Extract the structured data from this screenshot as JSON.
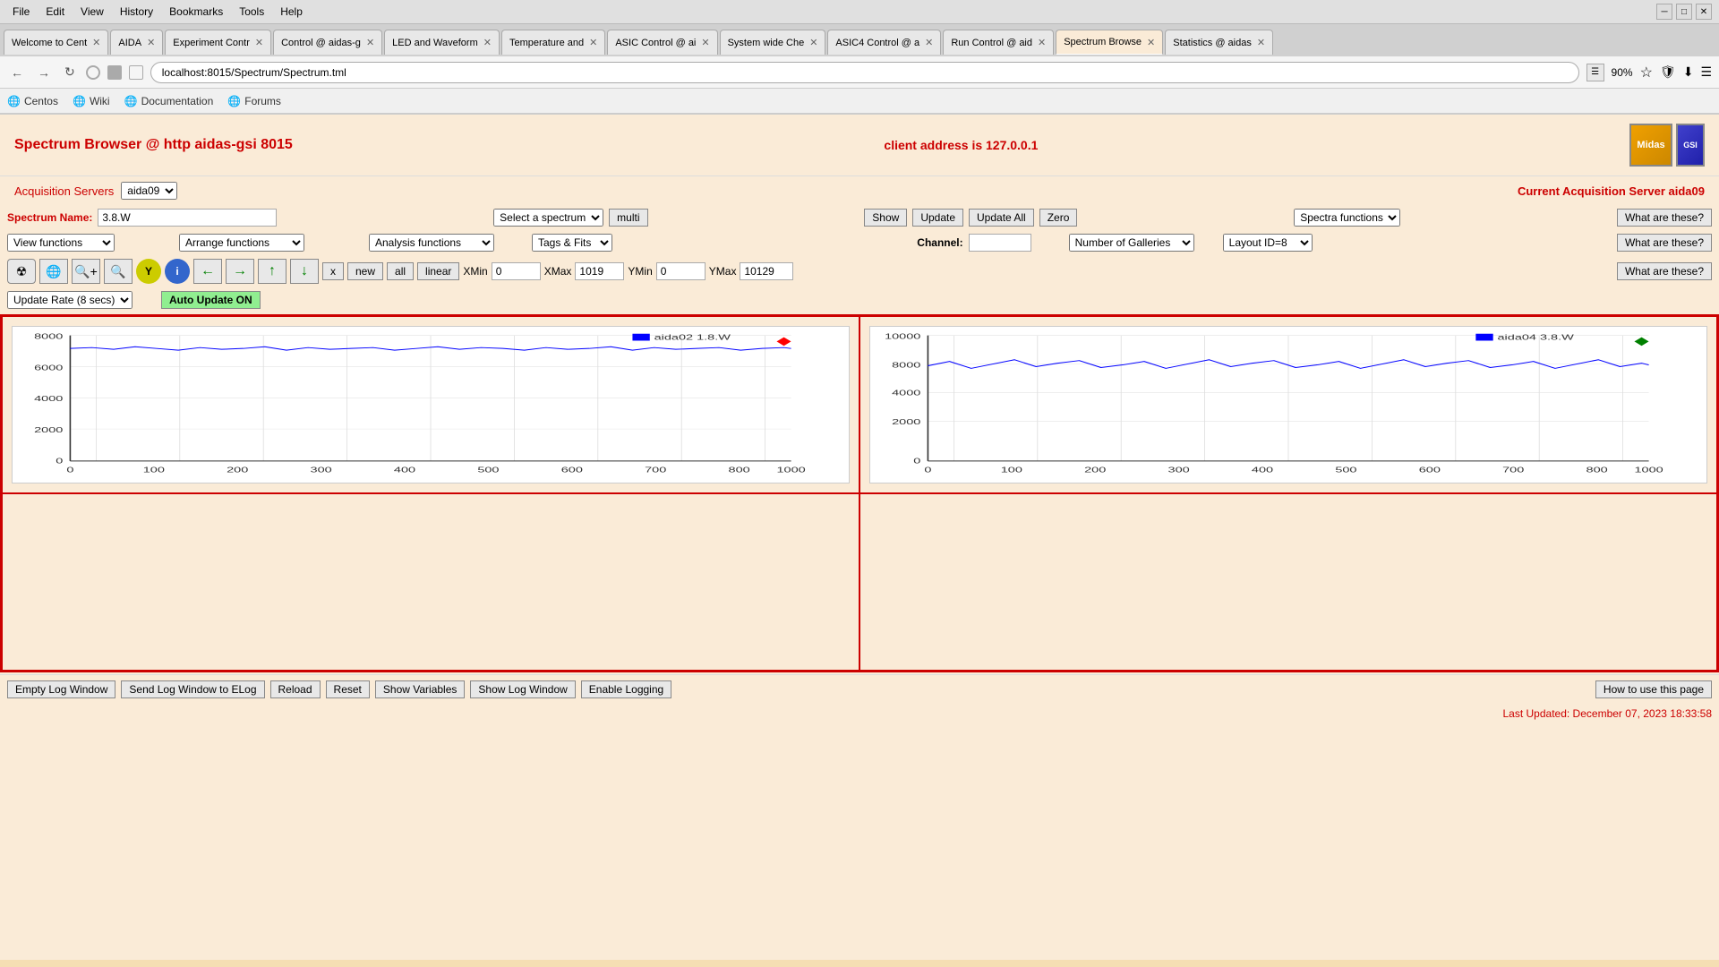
{
  "browser": {
    "menu": [
      "File",
      "Edit",
      "View",
      "History",
      "Bookmarks",
      "Tools",
      "Help"
    ],
    "tabs": [
      {
        "label": "Welcome to Cent",
        "active": false
      },
      {
        "label": "AIDA",
        "active": false
      },
      {
        "label": "Experiment Contr",
        "active": false
      },
      {
        "label": "Control @ aidas-g",
        "active": false
      },
      {
        "label": "LED and Waveform",
        "active": false
      },
      {
        "label": "Temperature and",
        "active": false
      },
      {
        "label": "ASIC Control @ ai",
        "active": false
      },
      {
        "label": "System wide Che",
        "active": false
      },
      {
        "label": "ASIC4 Control @ a",
        "active": false
      },
      {
        "label": "Run Control @ aid",
        "active": false
      },
      {
        "label": "Spectrum Browse",
        "active": true
      },
      {
        "label": "Statistics @ aidas",
        "active": false
      }
    ],
    "url": "localhost:8015/Spectrum/Spectrum.tml",
    "zoom": "90%",
    "bookmarks": [
      "Centos",
      "Wiki",
      "Documentation",
      "Forums"
    ]
  },
  "page": {
    "title": "Spectrum Browser @ http aidas-gsi 8015",
    "client_address_label": "client address is 127.0.0.1",
    "acq_servers_label": "Acquisition Servers",
    "acq_server_value": "aida09",
    "current_server_label": "Current Acquisition Server aida09",
    "spectrum_name_label": "Spectrum Name:",
    "spectrum_name_value": "3.8.W",
    "select_spectrum": "Select a spectrum",
    "multi_btn": "multi",
    "show_btn": "Show",
    "update_btn": "Update",
    "update_all_btn": "Update All",
    "zero_btn": "Zero",
    "spectra_functions": "Spectra functions",
    "what_are_these_1": "What are these?",
    "view_functions": "View functions",
    "arrange_functions": "Arrange functions",
    "analysis_functions": "Analysis functions",
    "tags_fits": "Tags & Fits",
    "channel_label": "Channel:",
    "channel_value": "",
    "number_of_galleries": "Number of Galleries",
    "layout_id": "Layout ID=8",
    "what_are_these_2": "What are these?",
    "x_btn": "x",
    "new_btn": "new",
    "all_btn": "all",
    "linear_btn": "linear",
    "xmin_label": "XMin",
    "xmin_value": "0",
    "xmax_label": "XMax",
    "xmax_value": "1019",
    "ymin_label": "YMin",
    "ymin_value": "0",
    "ymax_label": "YMax",
    "ymax_value": "10129",
    "what_are_these_3": "What are these?",
    "update_rate": "Update Rate (8 secs)",
    "auto_update_btn": "Auto Update ON",
    "chart1_label": "aida02 1.8.W",
    "chart2_label": "aida04 3.8.W",
    "footer": {
      "empty_log": "Empty Log Window",
      "send_log": "Send Log Window to ELog",
      "reload": "Reload",
      "reset": "Reset",
      "show_variables": "Show Variables",
      "show_log": "Show Log Window",
      "enable_logging": "Enable Logging",
      "how_to_use": "How to use this page",
      "last_updated": "Last Updated: December 07, 2023 18:33:58"
    }
  }
}
